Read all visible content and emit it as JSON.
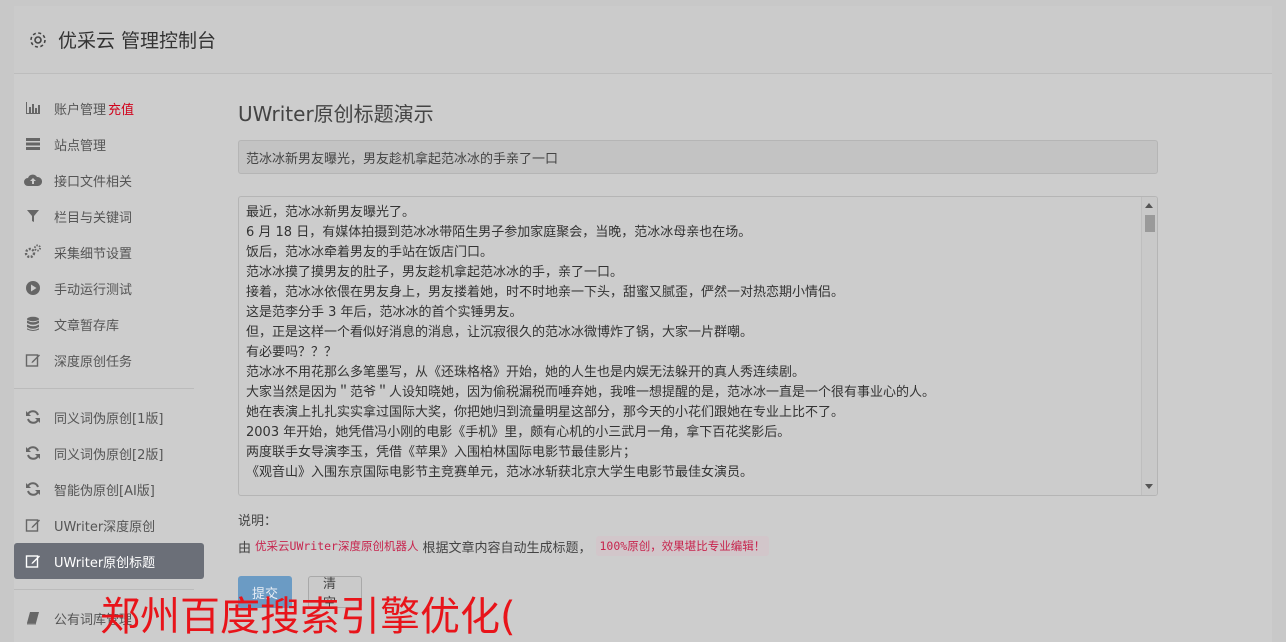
{
  "header": {
    "title": "优采云 管理控制台",
    "icon": "gear-icon"
  },
  "sidebar": {
    "items": [
      {
        "label": "账户管理",
        "accent": "充值",
        "icon": "bar-chart-icon"
      },
      {
        "label": "站点管理",
        "icon": "server-icon"
      },
      {
        "label": "接口文件相关",
        "icon": "cloud-upload-icon"
      },
      {
        "label": "栏目与关键词",
        "icon": "filter-icon"
      },
      {
        "label": "采集细节设置",
        "icon": "gears-icon"
      },
      {
        "label": "手动运行测试",
        "icon": "play-circle-icon"
      },
      {
        "label": "文章暂存库",
        "icon": "database-icon"
      },
      {
        "label": "深度原创任务",
        "icon": "edit-icon"
      }
    ],
    "items2": [
      {
        "label": "同义词伪原创[1版]",
        "icon": "refresh-icon"
      },
      {
        "label": "同义词伪原创[2版]",
        "icon": "refresh-icon"
      },
      {
        "label": "智能伪原创[AI版]",
        "icon": "refresh-icon"
      },
      {
        "label": "UWriter深度原创",
        "icon": "edit-icon"
      },
      {
        "label": "UWriter原创标题",
        "icon": "edit-icon",
        "active": true
      }
    ],
    "items3": [
      {
        "label": "公有词库管理",
        "icon": "book-icon"
      }
    ]
  },
  "main": {
    "page_title": "UWriter原创标题演示",
    "title_value": "范冰冰新男友曝光，男友趁机拿起范冰冰的手亲了一口",
    "article_lines": [
      "最近，范冰冰新男友曝光了。",
      "6 月 18 日，有媒体拍摄到范冰冰带陌生男子参加家庭聚会，当晚，范冰冰母亲也在场。",
      "饭后，范冰冰牵着男友的手站在饭店门口。",
      "范冰冰摸了摸男友的肚子，男友趁机拿起范冰冰的手，亲了一口。",
      "接着，范冰冰依偎在男友身上，男友搂着她，时不时地亲一下头，甜蜜又腻歪，俨然一对热恋期小情侣。",
      "这是范李分手 3 年后，范冰冰的首个实锤男友。",
      "但，正是这样一个看似好消息的消息，让沉寂很久的范冰冰微博炸了锅，大家一片群嘲。",
      "有必要吗？？？",
      "范冰冰不用花那么多笔墨写，从《还珠格格》开始，她的人生也是内娱无法躲开的真人秀连续剧。",
      "大家当然是因为＂范爷＂人设知晓她，因为偷税漏税而唾弃她，我唯一想提醒的是，范冰冰一直是一个很有事业心的人。",
      "她在表演上扎扎实实拿过国际大奖，你把她归到流量明星这部分，那今天的小花们跟她在专业上比不了。",
      "2003 年开始，她凭借冯小刚的电影《手机》里，颇有心机的小三武月一角，拿下百花奖影后。",
      "两度联手女导演李玉，凭借《苹果》入围柏林国际电影节最佳影片；",
      "《观音山》入围东京国际电影节主竞赛单元，范冰冰斩获北京大学生电影节最佳女演员。"
    ],
    "desc_label": "说明：",
    "desc_prefix": "由",
    "desc_code1": "优采云UWriter深度原创机器人",
    "desc_middle": "根据文章内容自动生成标题，",
    "desc_code2": "100%原创，效果堪比专业编辑！",
    "submit_label": "提交",
    "clear_label": "清空"
  },
  "watermark": "郑州百度搜索引擎优化(",
  "colors": {
    "accent_red": "#d0021b",
    "active_nav": "#6b6f78",
    "watermark": "#e8141a"
  }
}
